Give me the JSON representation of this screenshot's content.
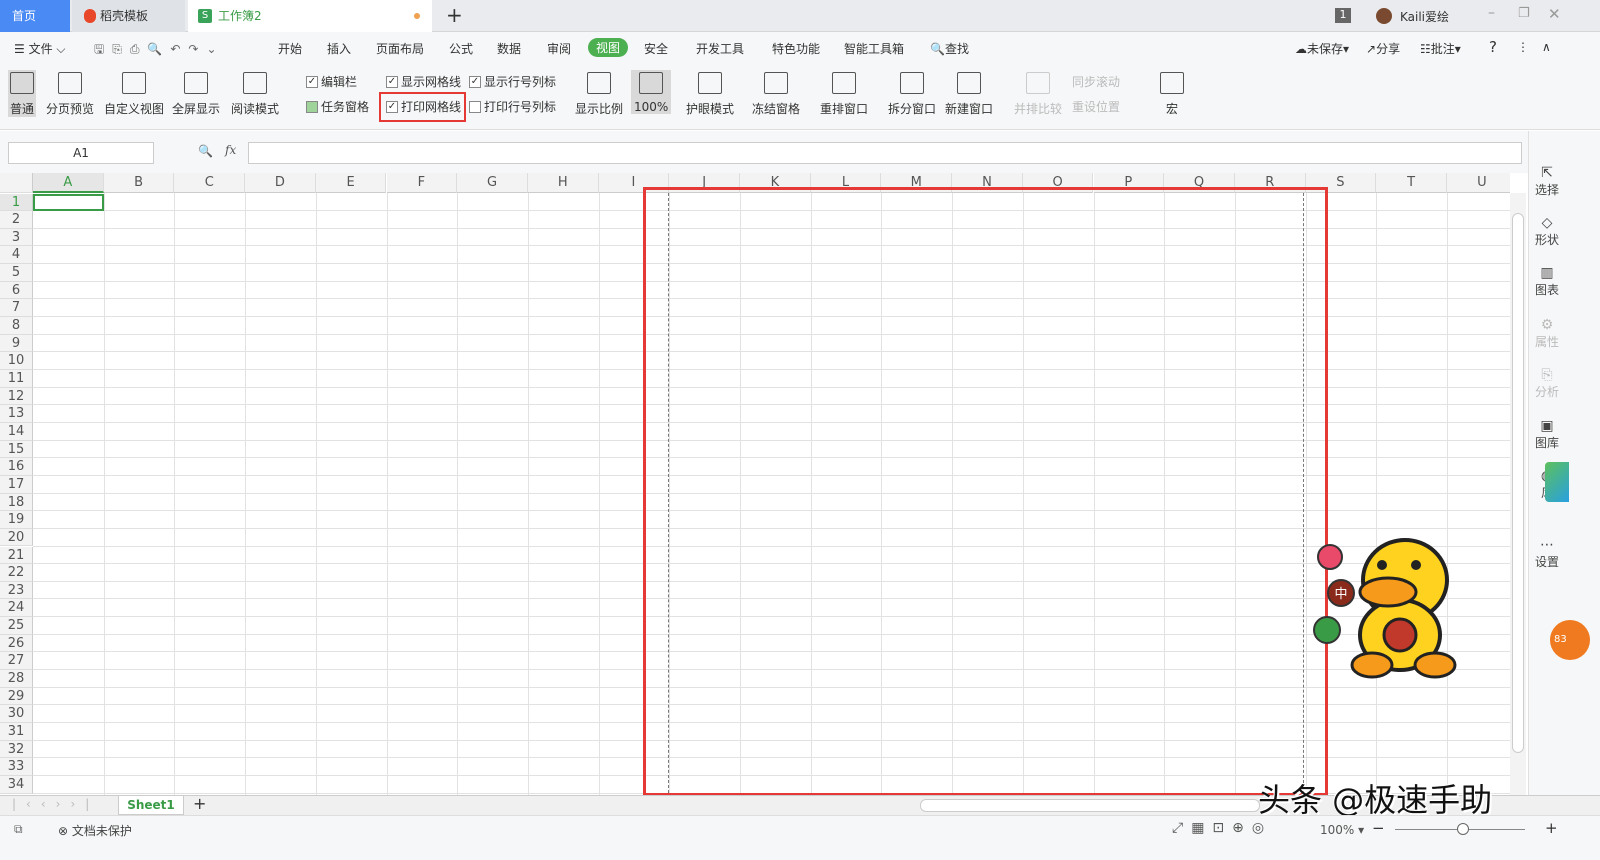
{
  "tabs": [
    {
      "label": "首页"
    },
    {
      "label": "稻壳模板"
    },
    {
      "label": "工作簿2"
    }
  ],
  "new_tab": "+",
  "window": {
    "notif_count": "1",
    "user": "Kaili爱绘"
  },
  "menu": {
    "file": "文件",
    "items": [
      "开始",
      "插入",
      "页面布局",
      "公式",
      "数据",
      "审阅",
      "视图",
      "安全",
      "开发工具",
      "特色功能",
      "智能工具箱"
    ],
    "active": "视图",
    "search": "查找",
    "unsaved": "未保存",
    "share": "分享",
    "comment": "批注"
  },
  "ribbon": {
    "buttons": [
      "普通",
      "分页预览",
      "自定义视图",
      "全屏显示",
      "阅读模式"
    ],
    "checks": [
      {
        "label": "编辑栏",
        "checked": true
      },
      {
        "label": "任务窗格",
        "checked": true
      },
      {
        "label": "显示网格线",
        "checked": true
      },
      {
        "label": "打印网格线",
        "checked": true
      },
      {
        "label": "显示行号列标",
        "checked": true
      },
      {
        "label": "打印行号列标",
        "checked": false
      }
    ],
    "buttons2": [
      "显示比例",
      "100%",
      "护眼模式",
      "冻结窗格",
      "重排窗口",
      "拆分窗口",
      "新建窗口",
      "并排比较",
      "宏"
    ],
    "small": [
      "同步滚动",
      "重设位置"
    ]
  },
  "formula": {
    "cell_ref": "A1",
    "fx": "fx",
    "value": ""
  },
  "grid": {
    "columns": [
      "A",
      "B",
      "C",
      "D",
      "E",
      "F",
      "G",
      "H",
      "I",
      "J",
      "K",
      "L",
      "M",
      "N",
      "O",
      "P",
      "Q",
      "R",
      "S",
      "T",
      "U"
    ],
    "row_count": 34,
    "selected": "A1"
  },
  "sidebar": [
    "选择",
    "形状",
    "图表",
    "属性",
    "分析",
    "图库",
    "风",
    "设置"
  ],
  "sheets": [
    "Sheet1"
  ],
  "status": {
    "protect": "文档未保护",
    "zoom": "100%"
  },
  "watermark": "头条 @极速手助",
  "mascot_badges": [
    "中"
  ],
  "colors": {
    "accent": "#4caf50",
    "highlight": "#e53935"
  }
}
